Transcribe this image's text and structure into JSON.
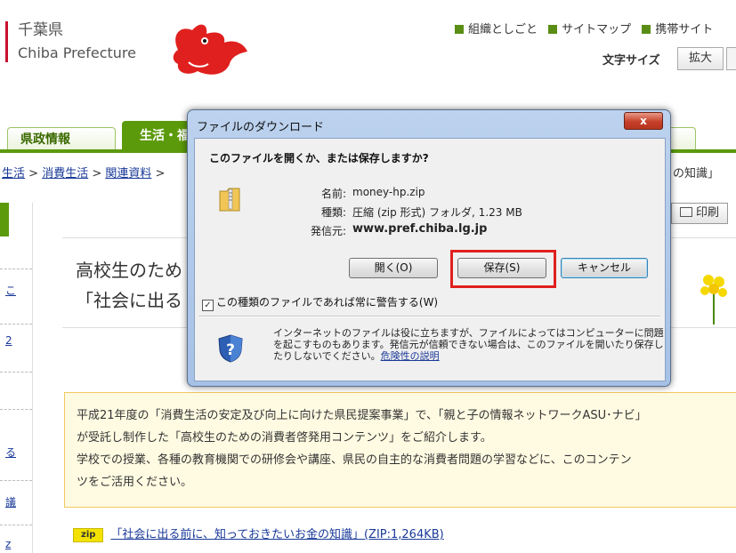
{
  "header": {
    "logo_jp": "千葉県",
    "logo_en": "Chiba Prefecture",
    "top_links": [
      "組織としごと",
      "サイトマップ",
      "携帯サイト"
    ],
    "font_size_label": "文字サイズ",
    "enlarge_button": "拡大"
  },
  "nav": {
    "tabs": [
      "県政情報",
      "生活・福"
    ]
  },
  "breadcrumb": {
    "items": [
      "生活",
      "消費生活",
      "関連資料"
    ],
    "separator": " > ",
    "trailing": " > ",
    "right_text": "の知識」"
  },
  "sidebar": {
    "links": [
      "こ",
      "2",
      "る",
      "議",
      "z"
    ]
  },
  "print_button": "印刷",
  "title": {
    "line1": "高校生のため",
    "line2": "「社会に出る"
  },
  "description": {
    "lines": [
      "平成21年度の「消費生活の安定及び向上に向けた県民提案事業」で、「親と子の情報ネットワークASU･ナビ」",
      "が受託し制作した「高校生のための消費者啓発用コンテンツ」をご紹介します。",
      "学校での授業、各種の教育機関での研修会や講座、県民の自主的な消費者問題の学習などに、このコンテン",
      "ツをご活用ください。"
    ]
  },
  "zip": {
    "badge": "zip",
    "link": "「社会に出る前に、知っておきたいお金の知識」(ZIP:1,264KB)"
  },
  "dialog": {
    "title": "ファイルのダウンロード",
    "close_label": "x",
    "question": "このファイルを開くか、または保存しますか?",
    "name_label": "名前:",
    "name_value": "money-hp.zip",
    "type_label": "種類:",
    "type_value": "圧縮 (zip 形式) フォルダ, 1.23 MB",
    "from_label": "発信元:",
    "from_value": "www.pref.chiba.lg.jp",
    "open_button": "開く(O)",
    "save_button": "保存(S)",
    "cancel_button": "キャンセル",
    "checkbox_label": "この種類のファイルであれば常に警告する(W)",
    "checkbox_checked": true,
    "warning_text": "インターネットのファイルは役に立ちますが、ファイルによってはコンピューターに問題を起こすものもあります。発信元が信頼できない場合は、このファイルを開いたり保存したりしないでください。",
    "risk_link": "危険性の説明"
  },
  "colors": {
    "brand_green": "#5b9a0a",
    "highlight_red": "#e0201e",
    "dialog_frame": "#a6c1e6"
  }
}
